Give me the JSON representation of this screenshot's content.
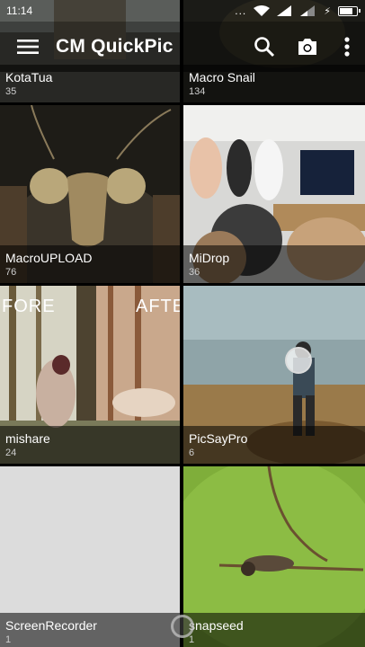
{
  "status": {
    "time": "11:14",
    "dots": "...",
    "battery_level": 0.8
  },
  "appbar": {
    "title": "CM QuickPic",
    "icons": [
      "menu-icon",
      "search-icon",
      "camera-icon",
      "more-vert-icon"
    ]
  },
  "albums": [
    {
      "name": "KotaTua",
      "count": "35"
    },
    {
      "name": "Macro Snail",
      "count": "134"
    },
    {
      "name": "MacroUPLOAD",
      "count": "76"
    },
    {
      "name": "MiDrop",
      "count": "36"
    },
    {
      "name": "mishare",
      "count": "24"
    },
    {
      "name": "PicSayPro",
      "count": "6"
    },
    {
      "name": "ScreenRecorder",
      "count": "1"
    },
    {
      "name": "snapseed",
      "count": "1"
    }
  ],
  "overlay_text": {
    "before": "FORE",
    "after": "AFTE"
  }
}
